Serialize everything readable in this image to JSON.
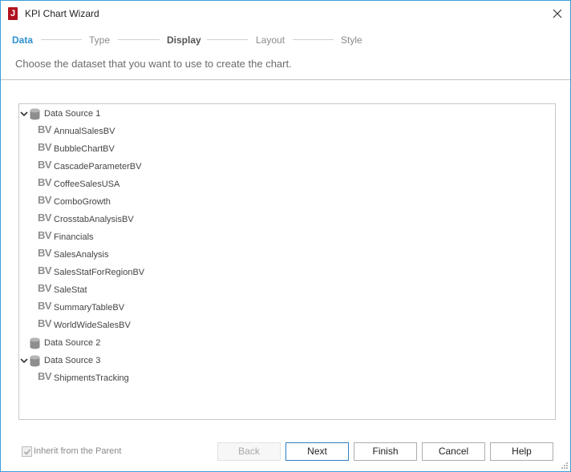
{
  "window": {
    "title": "KPI Chart Wizard",
    "app_icon_letter": "J"
  },
  "steps": [
    {
      "label": "Data",
      "state": "active"
    },
    {
      "label": "Type",
      "state": "normal"
    },
    {
      "label": "Display",
      "state": "bold"
    },
    {
      "label": "Layout",
      "state": "normal"
    },
    {
      "label": "Style",
      "state": "normal"
    }
  ],
  "instruction": "Choose the dataset that you want to use to create the chart.",
  "tree": {
    "sources": [
      {
        "label": "Data Source 1",
        "expanded": true,
        "items": [
          "AnnualSalesBV",
          "BubbleChartBV",
          "CascadeParameterBV",
          "CoffeeSalesUSA",
          "ComboGrowth",
          "CrosstabAnalysisBV",
          "Financials",
          "SalesAnalysis",
          "SalesStatForRegionBV",
          "SaleStat",
          "SummaryTableBV",
          "WorldWideSalesBV"
        ]
      },
      {
        "label": "Data Source 2",
        "expanded": false,
        "items": []
      },
      {
        "label": "Data Source 3",
        "expanded": true,
        "items": [
          "ShipmentsTracking"
        ]
      }
    ],
    "item_badge": "BV"
  },
  "inherit": {
    "label": "Inherit from the Parent",
    "checked": true,
    "enabled": false
  },
  "buttons": {
    "back": "Back",
    "next": "Next",
    "finish": "Finish",
    "cancel": "Cancel",
    "help": "Help"
  },
  "colors": {
    "accent": "#2d8fd0",
    "brand": "#b0131e",
    "window_border": "#3c9fd6"
  }
}
